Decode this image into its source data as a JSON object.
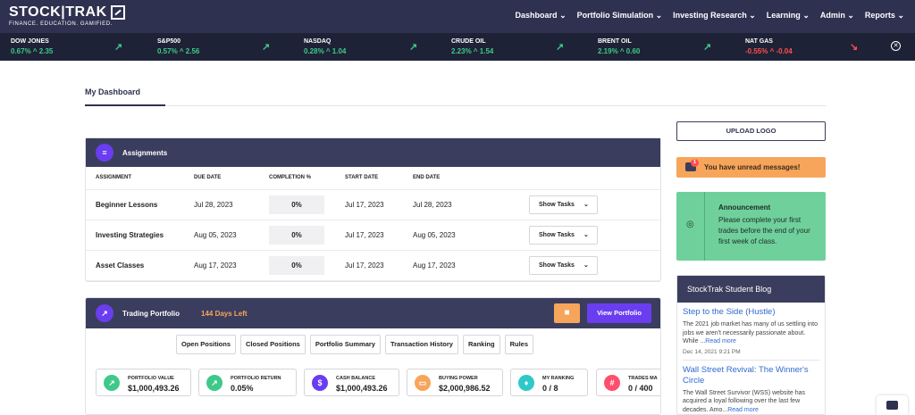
{
  "brand": {
    "name": "STOCK|TRAK",
    "tagline": "FINANCE. EDUCATION. GAMIFIED."
  },
  "nav": [
    {
      "label": "Dashboard"
    },
    {
      "label": "Portfolio Simulation"
    },
    {
      "label": "Investing Research"
    },
    {
      "label": "Learning"
    },
    {
      "label": "Admin"
    },
    {
      "label": "Reports"
    }
  ],
  "ticker": [
    {
      "name": "DOW JONES",
      "change": "0.67% ^ 2.35",
      "direction": "up"
    },
    {
      "name": "S&P500",
      "change": "0.57% ^ 2.56",
      "direction": "up"
    },
    {
      "name": "NASDAQ",
      "change": "0.28% ^ 1.04",
      "direction": "up"
    },
    {
      "name": "CRUDE OIL",
      "change": "2.23% ^ 1.54",
      "direction": "up"
    },
    {
      "name": "BRENT OIL",
      "change": "2.19% ^ 0.60",
      "direction": "up"
    },
    {
      "name": "NAT GAS",
      "change": "-0.55% ^ -0.04",
      "direction": "down"
    }
  ],
  "dashboard": {
    "title": "My Dashboard"
  },
  "assignments": {
    "title": "Assignments",
    "columns": [
      "ASSIGNMENT",
      "DUE DATE",
      "COMPLETION %",
      "START DATE",
      "END DATE"
    ],
    "rows": [
      {
        "name": "Beginner Lessons",
        "due": "Jul 28, 2023",
        "completion": "0%",
        "start": "Jul 17, 2023",
        "end": "Jul 28, 2023",
        "action": "Show Tasks"
      },
      {
        "name": "Investing Strategies",
        "due": "Aug 05, 2023",
        "completion": "0%",
        "start": "Jul 17, 2023",
        "end": "Aug 05, 2023",
        "action": "Show Tasks"
      },
      {
        "name": "Asset Classes",
        "due": "Aug 17, 2023",
        "completion": "0%",
        "start": "Jul 17, 2023",
        "end": "Aug 17, 2023",
        "action": "Show Tasks"
      }
    ]
  },
  "portfolio": {
    "title": "Trading Portfolio",
    "days_left": "144 Days Left",
    "view_label": "View Portfolio",
    "tabs": [
      "Open Positions",
      "Closed Positions",
      "Portfolio Summary",
      "Transaction History",
      "Ranking",
      "Rules"
    ],
    "stats": [
      {
        "label": "PORTFOLIO VALUE",
        "value": "$1,000,493.26",
        "color": "#3ec98a",
        "icon": "arrow-up-right-icon"
      },
      {
        "label": "PORTFOLIO RETURN",
        "value": "0.05%",
        "color": "#3ec98a",
        "icon": "arrow-up-right-icon"
      },
      {
        "label": "CASH BALANCE",
        "value": "$1,000,493.26",
        "color": "#6a3df0",
        "icon": "dollar-icon"
      },
      {
        "label": "BUYING POWER",
        "value": "$2,000,986.52",
        "color": "#f7a55b",
        "icon": "wallet-icon"
      },
      {
        "label": "MY RANKING",
        "value": "0 / 8",
        "color": "#2fc8c8",
        "icon": "trophy-icon"
      },
      {
        "label": "TRADES MA",
        "value": "0 / 400",
        "color": "#ff4f6d",
        "icon": "tally-icon"
      }
    ]
  },
  "sidebar": {
    "upload_label": "UPLOAD LOGO",
    "message": {
      "text": "You have unread messages!",
      "count": "1"
    },
    "announcement": {
      "title": "Announcement",
      "text": "Please complete your first trades before the end of your first week of class."
    },
    "blog": {
      "title": "StockTrak Student Blog",
      "posts": [
        {
          "title": "Step to the Side (Hustle)",
          "text": "The 2021 job market has many of us settling into jobs we aren't necessarily passionate about. While ...",
          "more": "Read more",
          "date": "Dec 14, 2021 9:21 PM"
        },
        {
          "title": "Wall Street Revival: The Winner's Circle",
          "text": "The Wall Street Survivor (WSS) website has acquired a loyal following over the last few decades. Amo...",
          "more": "Read more",
          "date": ""
        }
      ]
    }
  }
}
